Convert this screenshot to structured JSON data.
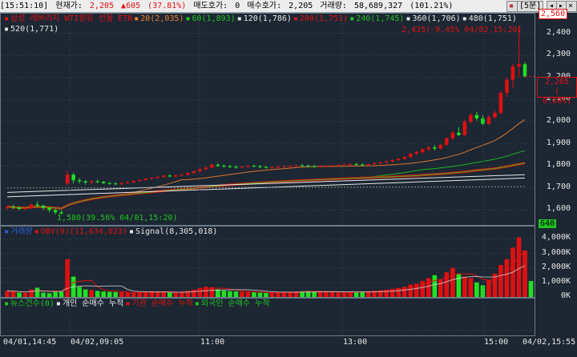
{
  "topbar": {
    "time": "[15:51:10]",
    "current_label": "현재가:",
    "current_value": "2,205",
    "change_value": "▲605",
    "change_pct": "(37.81%)",
    "ask_label": "매도호가:",
    "ask_value": "0",
    "bid_label": "매수호가:",
    "bid_value": "2,205",
    "volume_label": "거래량:",
    "volume_value": "58,689,327",
    "volume_pct": "(101.21%)",
    "period_button": "[5분]"
  },
  "price_panel": {
    "legend": [
      {
        "text": "삼성 레버리지 WTI원유 선물 ETN",
        "color": "#e01010"
      },
      {
        "text": "20(2,035)",
        "color": "#f08030"
      },
      {
        "text": "60(1,893)",
        "color": "#22c322"
      },
      {
        "text": "120(1,786)",
        "color": "#e8e8e8"
      },
      {
        "text": "200(1,751)",
        "color": "#e01010"
      },
      {
        "text": "240(1,745)",
        "color": "#22c322"
      },
      {
        "text": "360(1,706)",
        "color": "#e8e8e8"
      },
      {
        "text": "480(1,751)",
        "color": "#e8e8e8"
      }
    ],
    "legend2": "520(1,771)",
    "high_note": "2,435(-9.45% 04/02,15:20)",
    "low_note": "1,580(39.56% 04/01,15:20)",
    "high_tag": "2,560",
    "current_price": "2,205",
    "current_change": "( 0.00%)",
    "y_ticks": [
      "2,400",
      "2,300",
      "2,200",
      "2,100",
      "2,000",
      "1,900",
      "1,800",
      "1,700",
      "1,600"
    ]
  },
  "volume_panel": {
    "legend": [
      {
        "text": "거래량",
        "color": "#2f5dd0"
      },
      {
        "text": "OBV(9)(11,634,023)",
        "color": "#e01010"
      },
      {
        "text": "Signal(8,305,018)",
        "color": "#e8e8e8"
      }
    ],
    "y_ticks": [
      "4,000K",
      "3,000K",
      "2,000K",
      "1,000K",
      "0K"
    ],
    "vol_tag": "640"
  },
  "investor_panel": {
    "legend": [
      {
        "text": "뉴스건수(0)",
        "color": "#22c322"
      },
      {
        "text": "개인 순매수 누적",
        "color": "#e8e8e8"
      },
      {
        "text": "기관 순매수 누적",
        "color": "#e01010"
      },
      {
        "text": "외국인 순매수 누적",
        "color": "#22c322"
      }
    ]
  },
  "x_labels": [
    "04/01,14:45",
    "04/02,09:05",
    "11:00",
    "13:00",
    "15:00",
    "04/02,15:55"
  ],
  "chart_data": {
    "type": "candlestick",
    "title": "삼성 레버리지 WTI원유 선물 ETN",
    "interval": "5분",
    "ylim": [
      1540,
      2460
    ],
    "ohlc": [
      [
        1610,
        1620,
        1600,
        1615
      ],
      [
        1615,
        1625,
        1605,
        1612
      ],
      [
        1612,
        1618,
        1600,
        1605
      ],
      [
        1605,
        1615,
        1598,
        1610
      ],
      [
        1610,
        1630,
        1605,
        1625
      ],
      [
        1625,
        1640,
        1615,
        1620
      ],
      [
        1620,
        1625,
        1600,
        1610
      ],
      [
        1610,
        1615,
        1590,
        1600
      ],
      [
        1600,
        1605,
        1580,
        1590
      ],
      [
        1590,
        1600,
        1580,
        1585
      ],
      [
        1720,
        1780,
        1710,
        1760
      ],
      [
        1760,
        1770,
        1720,
        1735
      ],
      [
        1735,
        1745,
        1720,
        1730
      ],
      [
        1730,
        1735,
        1715,
        1725
      ],
      [
        1725,
        1735,
        1718,
        1730
      ],
      [
        1730,
        1738,
        1722,
        1728
      ],
      [
        1728,
        1732,
        1718,
        1722
      ],
      [
        1722,
        1728,
        1715,
        1720
      ],
      [
        1720,
        1726,
        1714,
        1718
      ],
      [
        1718,
        1726,
        1712,
        1722
      ],
      [
        1722,
        1730,
        1718,
        1726
      ],
      [
        1726,
        1735,
        1722,
        1732
      ],
      [
        1732,
        1740,
        1728,
        1736
      ],
      [
        1736,
        1745,
        1732,
        1742
      ],
      [
        1742,
        1750,
        1738,
        1746
      ],
      [
        1746,
        1755,
        1742,
        1750
      ],
      [
        1750,
        1760,
        1745,
        1756
      ],
      [
        1756,
        1762,
        1748,
        1752
      ],
      [
        1752,
        1760,
        1746,
        1758
      ],
      [
        1758,
        1765,
        1752,
        1760
      ],
      [
        1760,
        1772,
        1755,
        1768
      ],
      [
        1768,
        1780,
        1762,
        1775
      ],
      [
        1775,
        1790,
        1770,
        1785
      ],
      [
        1785,
        1800,
        1778,
        1792
      ],
      [
        1792,
        1810,
        1788,
        1805
      ],
      [
        1805,
        1812,
        1795,
        1800
      ],
      [
        1800,
        1808,
        1792,
        1798
      ],
      [
        1798,
        1805,
        1790,
        1796
      ],
      [
        1796,
        1802,
        1788,
        1794
      ],
      [
        1794,
        1800,
        1788,
        1796
      ],
      [
        1796,
        1804,
        1790,
        1800
      ],
      [
        1800,
        1806,
        1794,
        1798
      ],
      [
        1798,
        1804,
        1790,
        1795
      ],
      [
        1795,
        1800,
        1788,
        1792
      ],
      [
        1792,
        1798,
        1786,
        1794
      ],
      [
        1794,
        1800,
        1788,
        1796
      ],
      [
        1796,
        1802,
        1790,
        1798
      ],
      [
        1798,
        1804,
        1792,
        1800
      ],
      [
        1800,
        1806,
        1794,
        1802
      ],
      [
        1802,
        1808,
        1796,
        1800
      ],
      [
        1800,
        1806,
        1794,
        1798
      ],
      [
        1798,
        1804,
        1792,
        1796
      ],
      [
        1796,
        1802,
        1790,
        1798
      ],
      [
        1798,
        1804,
        1792,
        1800
      ],
      [
        1800,
        1806,
        1794,
        1802
      ],
      [
        1802,
        1808,
        1796,
        1804
      ],
      [
        1804,
        1810,
        1798,
        1806
      ],
      [
        1806,
        1812,
        1800,
        1808
      ],
      [
        1808,
        1814,
        1802,
        1806
      ],
      [
        1806,
        1812,
        1800,
        1804
      ],
      [
        1804,
        1810,
        1798,
        1808
      ],
      [
        1808,
        1816,
        1802,
        1812
      ],
      [
        1812,
        1820,
        1806,
        1816
      ],
      [
        1816,
        1824,
        1810,
        1820
      ],
      [
        1820,
        1830,
        1814,
        1826
      ],
      [
        1826,
        1836,
        1820,
        1832
      ],
      [
        1832,
        1845,
        1826,
        1840
      ],
      [
        1840,
        1860,
        1834,
        1855
      ],
      [
        1855,
        1870,
        1848,
        1862
      ],
      [
        1862,
        1880,
        1855,
        1875
      ],
      [
        1875,
        1890,
        1866,
        1884
      ],
      [
        1884,
        1895,
        1870,
        1878
      ],
      [
        1878,
        1900,
        1872,
        1895
      ],
      [
        1895,
        1930,
        1890,
        1925
      ],
      [
        1925,
        1960,
        1915,
        1950
      ],
      [
        1950,
        1975,
        1935,
        1940
      ],
      [
        1940,
        2010,
        1935,
        2000
      ],
      [
        2000,
        2040,
        1990,
        2030
      ],
      [
        2030,
        2045,
        2005,
        2015
      ],
      [
        2015,
        2030,
        1985,
        1990
      ],
      [
        1990,
        2030,
        1985,
        2020
      ],
      [
        2020,
        2050,
        2010,
        2040
      ],
      [
        2040,
        2140,
        2030,
        2130
      ],
      [
        2130,
        2200,
        2110,
        2190
      ],
      [
        2190,
        2260,
        2150,
        2250
      ],
      [
        2250,
        2435,
        2200,
        2260
      ],
      [
        2260,
        2270,
        2200,
        2205
      ]
    ],
    "ma_series": [
      {
        "name": "20",
        "color": "#f08030",
        "last": 2035
      },
      {
        "name": "60",
        "color": "#22c322",
        "last": 1893
      },
      {
        "name": "120",
        "color": "#e8e8e8",
        "last": 1786
      },
      {
        "name": "200",
        "color": "#e01010",
        "last": 1751
      },
      {
        "name": "240",
        "color": "#22c322",
        "last": 1745
      },
      {
        "name": "360",
        "color": "#e8e8e8",
        "last": 1706
      },
      {
        "name": "480",
        "color": "#e8e8e8",
        "last": 1751
      },
      {
        "name": "520",
        "color": "#e8e8e8",
        "last": 1771
      }
    ],
    "volume_ylim": [
      0,
      4300
    ],
    "volume_k": [
      420,
      380,
      300,
      280,
      520,
      640,
      300,
      260,
      340,
      360,
      2600,
      1400,
      700,
      520,
      480,
      420,
      380,
      360,
      340,
      320,
      300,
      280,
      320,
      360,
      400,
      380,
      340,
      300,
      280,
      360,
      420,
      500,
      620,
      700,
      680,
      520,
      440,
      400,
      380,
      360,
      340,
      320,
      300,
      280,
      300,
      320,
      340,
      360,
      380,
      400,
      420,
      380,
      360,
      340,
      320,
      300,
      320,
      340,
      360,
      380,
      400,
      420,
      460,
      500,
      560,
      620,
      700,
      860,
      920,
      1100,
      1300,
      1500,
      1200,
      1700,
      2000,
      1600,
      1400,
      1300,
      1000,
      800,
      1200,
      1600,
      2200,
      2600,
      3400,
      4100,
      3200,
      1100
    ],
    "volume_up": [
      true,
      true,
      false,
      true,
      true,
      false,
      false,
      false,
      false,
      false,
      true,
      false,
      false,
      false,
      true,
      false,
      false,
      false,
      false,
      true,
      true,
      true,
      true,
      true,
      true,
      true,
      true,
      false,
      true,
      true,
      true,
      true,
      true,
      true,
      true,
      false,
      false,
      false,
      false,
      true,
      true,
      false,
      false,
      false,
      true,
      true,
      true,
      true,
      true,
      false,
      false,
      false,
      true,
      true,
      true,
      true,
      true,
      true,
      false,
      false,
      true,
      true,
      true,
      true,
      true,
      true,
      true,
      true,
      true,
      true,
      true,
      false,
      true,
      true,
      true,
      false,
      true,
      true,
      false,
      false,
      true,
      true,
      true,
      true,
      true,
      true,
      true,
      false
    ]
  }
}
